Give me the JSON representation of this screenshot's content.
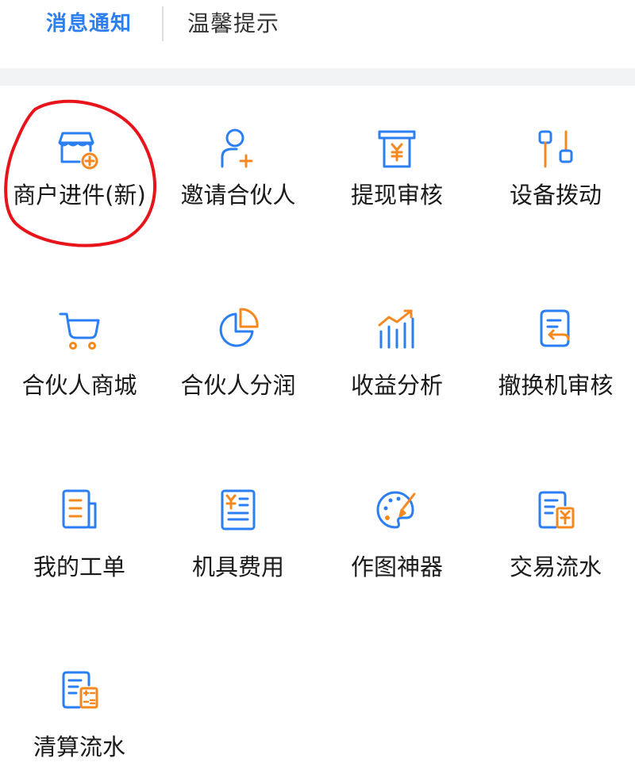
{
  "header": {
    "tabs": [
      {
        "label": "消息通知",
        "active": true
      },
      {
        "label": "温馨提示",
        "active": false
      }
    ]
  },
  "menu": {
    "items": [
      {
        "label": "商户进件(新)",
        "icon": "store-add-icon"
      },
      {
        "label": "邀请合伙人",
        "icon": "add-person-icon"
      },
      {
        "label": "提现审核",
        "icon": "atm-withdraw-icon"
      },
      {
        "label": "设备拨动",
        "icon": "device-adjust-icon"
      },
      {
        "label": "合伙人商城",
        "icon": "shopping-cart-icon"
      },
      {
        "label": "合伙人分润",
        "icon": "pie-chart-icon"
      },
      {
        "label": "收益分析",
        "icon": "trend-chart-icon"
      },
      {
        "label": "撤换机审核",
        "icon": "return-document-icon"
      },
      {
        "label": "我的工单",
        "icon": "work-order-icon"
      },
      {
        "label": "机具费用",
        "icon": "fee-document-icon"
      },
      {
        "label": "作图神器",
        "icon": "palette-icon"
      },
      {
        "label": "交易流水",
        "icon": "transaction-record-icon"
      },
      {
        "label": "清算流水",
        "icon": "settlement-record-icon"
      }
    ]
  },
  "colors": {
    "accent_blue": "#2c7ff2",
    "accent_orange": "#f5891f",
    "annotation_red": "#e8141c",
    "text": "#1a1a1a",
    "separator": "#f2f3f5"
  }
}
